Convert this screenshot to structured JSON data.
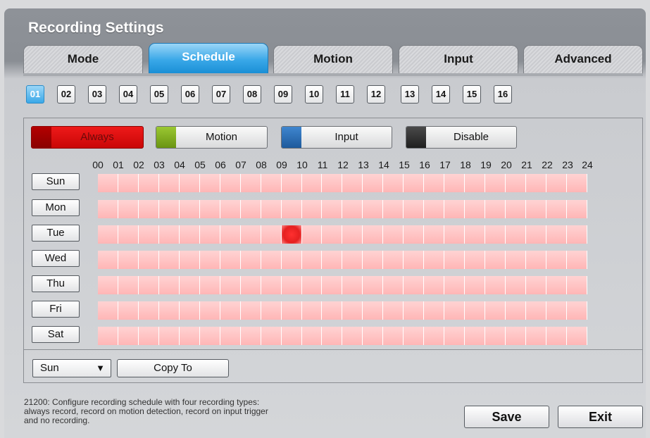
{
  "window": {
    "title": "Recording Settings"
  },
  "tabs": [
    {
      "label": "Mode",
      "active": false
    },
    {
      "label": "Schedule",
      "active": true
    },
    {
      "label": "Motion",
      "active": false
    },
    {
      "label": "Input",
      "active": false
    },
    {
      "label": "Advanced",
      "active": false
    }
  ],
  "channels": {
    "items": [
      "01",
      "02",
      "03",
      "04",
      "05",
      "06",
      "07",
      "08",
      "09",
      "10",
      "11",
      "12",
      "13",
      "14",
      "15",
      "16"
    ],
    "selected": "01"
  },
  "legend": [
    {
      "label": "Always",
      "color": "#e01010",
      "selected": true
    },
    {
      "label": "Motion",
      "color": "#7fae19"
    },
    {
      "label": "Input",
      "color": "#2b6cb5"
    },
    {
      "label": "Disable",
      "color": "#333333"
    }
  ],
  "schedule": {
    "hours": [
      "00",
      "01",
      "02",
      "03",
      "04",
      "05",
      "06",
      "07",
      "08",
      "09",
      "10",
      "11",
      "12",
      "13",
      "14",
      "15",
      "16",
      "17",
      "18",
      "19",
      "20",
      "21",
      "22",
      "23",
      "24"
    ],
    "days": [
      "Sun",
      "Mon",
      "Tue",
      "Wed",
      "Thu",
      "Fri",
      "Sat"
    ],
    "cell_color": "#ffc0c0",
    "highlighted": {
      "day": "Tue",
      "hour": "09"
    }
  },
  "copy": {
    "day_select_value": "Sun",
    "dropdown_icon": "triangle-down-icon",
    "copy_label": "Copy To"
  },
  "help_text": [
    "21200: Configure recording schedule with four recording types:",
    "always record, record on motion detection, record on input trigger",
    "and no recording."
  ],
  "actions": {
    "save_label": "Save",
    "exit_label": "Exit"
  }
}
